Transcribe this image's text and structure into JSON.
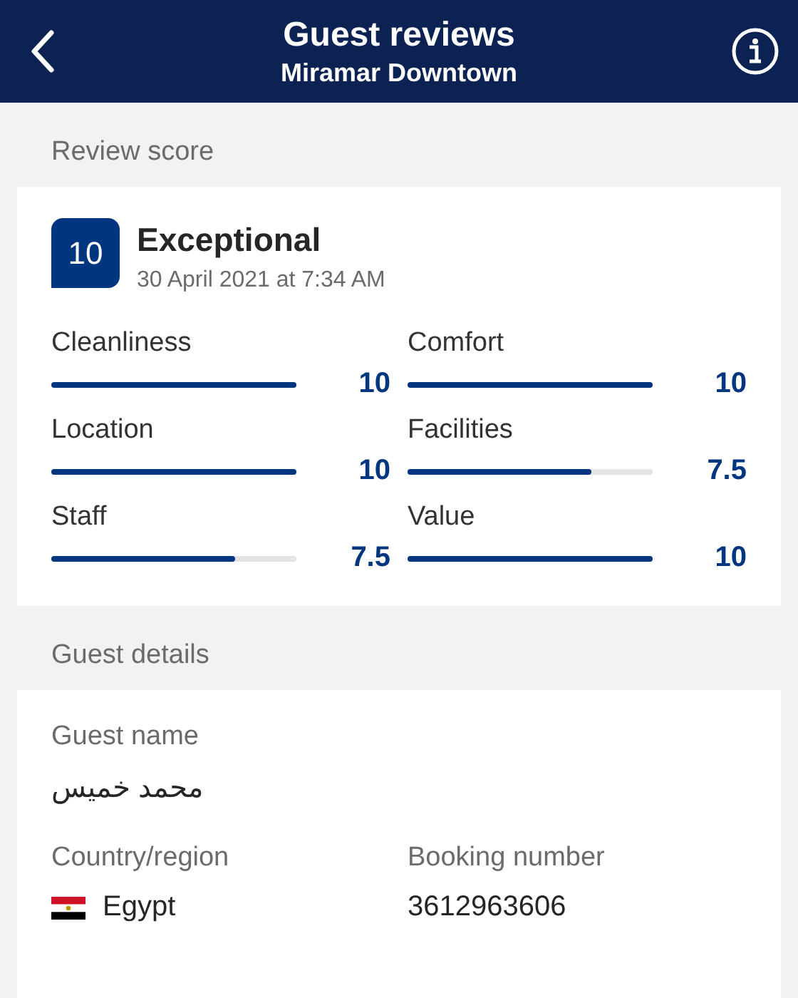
{
  "header": {
    "title": "Guest reviews",
    "subtitle": "Miramar Downtown"
  },
  "review_section": {
    "label": "Review score",
    "score": "10",
    "rating": "Exceptional",
    "date": "30 April 2021 at 7:34 AM",
    "categories": [
      {
        "name": "Cleanliness",
        "level": 1,
        "reading": "10"
      },
      {
        "name": "Comfort",
        "level": 1,
        "reading": "10"
      },
      {
        "name": "Location",
        "level": 1,
        "reading": "10"
      },
      {
        "name": "Facilities",
        "level": 0.75,
        "reading": "7.5"
      },
      {
        "name": "Staff",
        "level": 0.75,
        "reading": "7.5"
      },
      {
        "name": "Value",
        "level": 1,
        "reading": "10"
      }
    ]
  },
  "guest_section": {
    "label": "Guest details",
    "guest_name_label": "Guest name",
    "guest_name": "محمد خميس",
    "country_label": "Country/region",
    "country": "Egypt",
    "booking_label": "Booking number",
    "booking_number": "3612963606"
  }
}
